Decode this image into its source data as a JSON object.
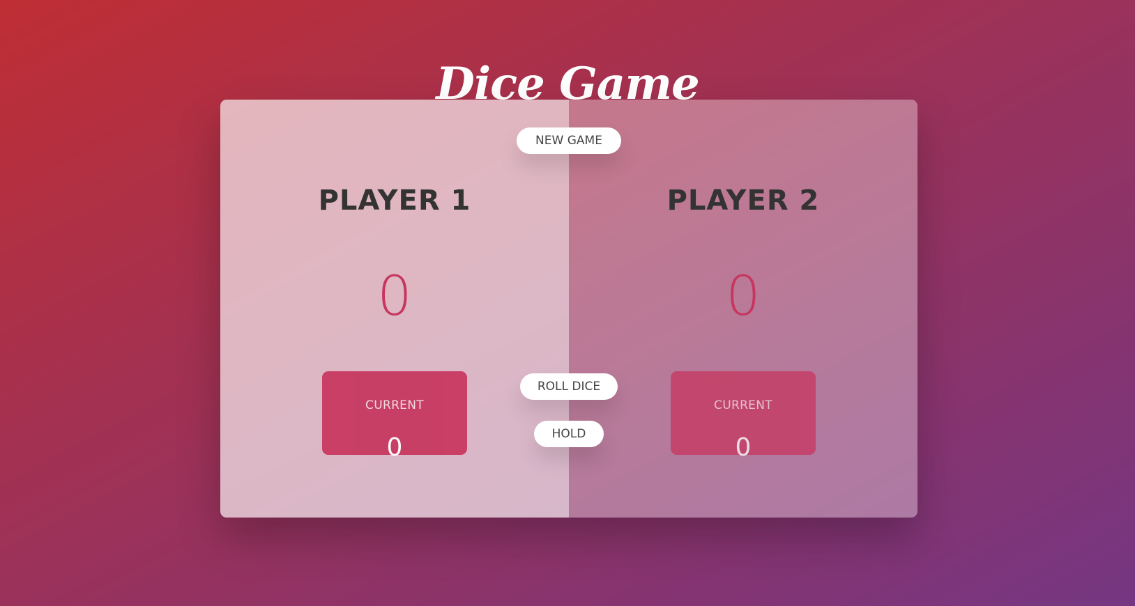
{
  "title": "Dice Game",
  "players": [
    {
      "name": "PLAYER 1",
      "score": "0",
      "current_label": "CURRENT",
      "current_score": "0",
      "active": true
    },
    {
      "name": "PLAYER 2",
      "score": "0",
      "current_label": "CURRENT",
      "current_score": "0",
      "active": false
    }
  ],
  "buttons": {
    "new_game": "NEW GAME",
    "roll_dice": "ROLL DICE",
    "hold": "HOLD"
  },
  "colors": {
    "accent": "#c7365f",
    "gradient_start": "#bf2e34",
    "gradient_end": "#753682"
  }
}
